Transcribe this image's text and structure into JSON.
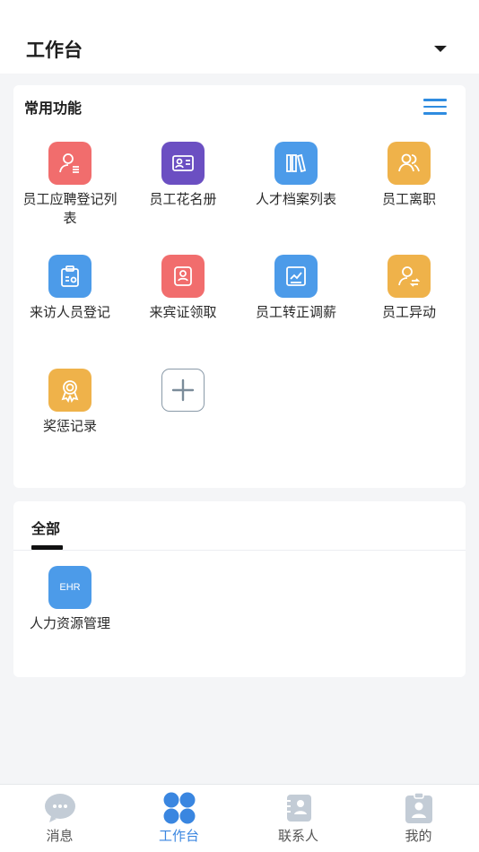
{
  "header": {
    "title": "工作台"
  },
  "common": {
    "title": "常用功能",
    "items": [
      {
        "label": "员工应聘登记列表",
        "icon": "person-list-icon",
        "color": "#f16d6d"
      },
      {
        "label": "员工花名册",
        "icon": "id-card-icon",
        "color": "#6b4fc2"
      },
      {
        "label": "人才档案列表",
        "icon": "books-icon",
        "color": "#4c9be9"
      },
      {
        "label": "员工离职",
        "icon": "people-icon",
        "color": "#efb24a"
      },
      {
        "label": "来访人员登记",
        "icon": "clipboard-icon",
        "color": "#4c9be9"
      },
      {
        "label": "来宾证领取",
        "icon": "badge-icon",
        "color": "#f16d6d"
      },
      {
        "label": "员工转正调薪",
        "icon": "chart-icon",
        "color": "#4c9be9"
      },
      {
        "label": "员工异动",
        "icon": "person-transfer-icon",
        "color": "#efb24a"
      },
      {
        "label": "奖惩记录",
        "icon": "medal-icon",
        "color": "#efb24a"
      }
    ]
  },
  "all": {
    "tab": "全部",
    "apps": [
      {
        "label": "人力资源管理",
        "icon_text": "EHR",
        "color": "#4c9be9"
      }
    ]
  },
  "tabbar": {
    "items": [
      {
        "label": "消息",
        "icon": "chat-bubble-icon"
      },
      {
        "label": "工作台",
        "icon": "workbench-icon",
        "active": true
      },
      {
        "label": "联系人",
        "icon": "contacts-icon"
      },
      {
        "label": "我的",
        "icon": "profile-icon"
      }
    ],
    "active_color": "#3a86e0",
    "inactive_color": "#555555"
  }
}
